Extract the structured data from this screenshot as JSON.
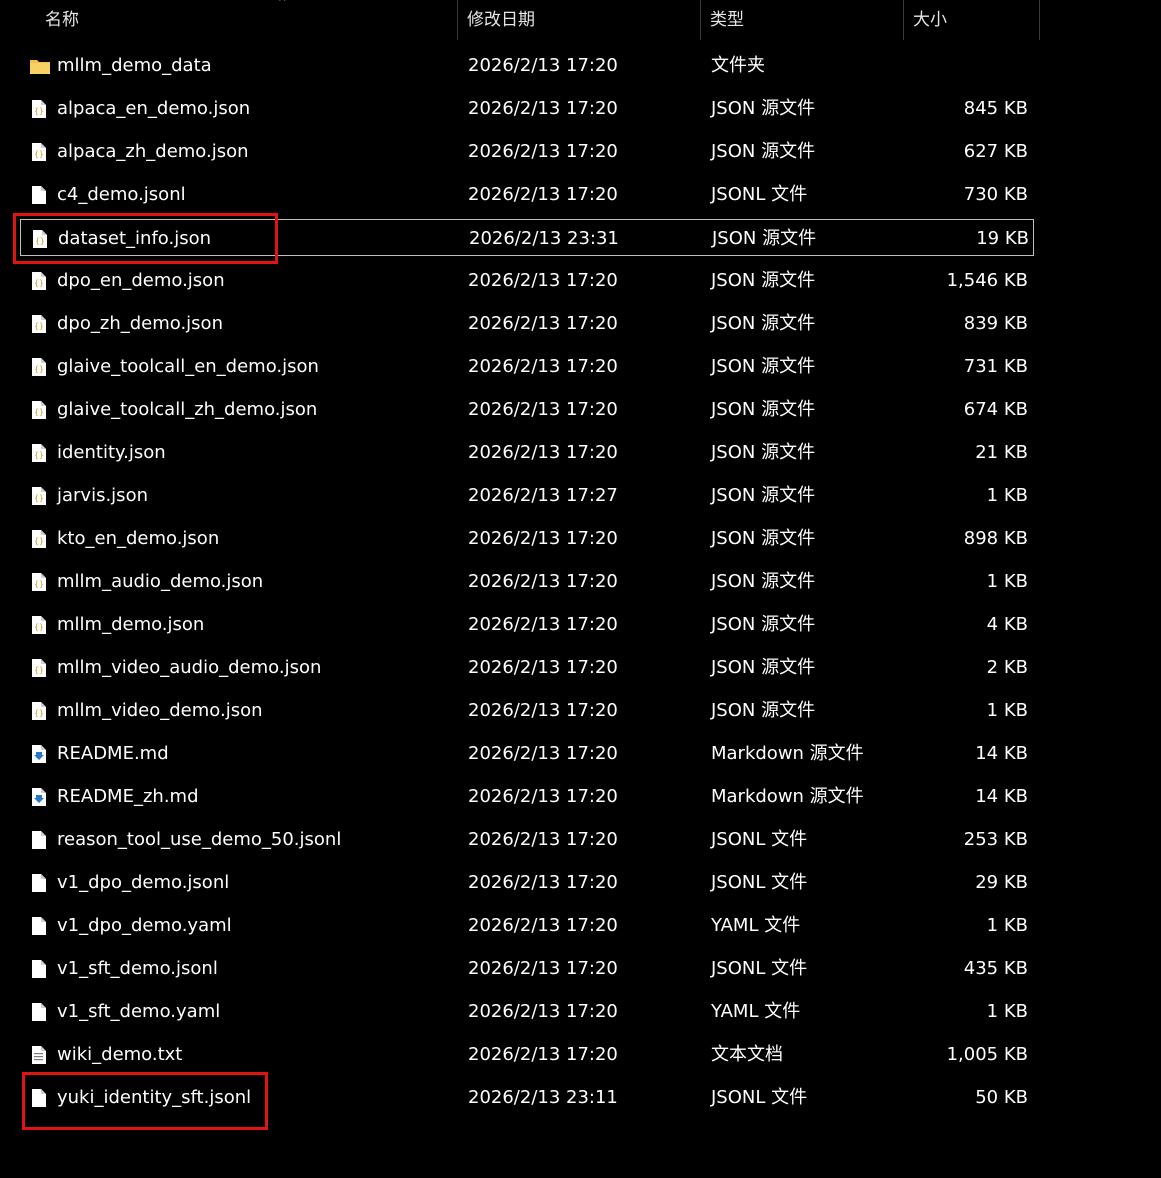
{
  "columns": {
    "name": "名称",
    "date": "修改日期",
    "type": "类型",
    "size": "大小"
  },
  "sort": {
    "column": "name",
    "direction": "ascending",
    "indicator": "^"
  },
  "files": [
    {
      "icon": "folder",
      "name": "mllm_demo_data",
      "date": "2026/2/13 17:20",
      "type": "文件夹",
      "size": ""
    },
    {
      "icon": "json",
      "name": "alpaca_en_demo.json",
      "date": "2026/2/13 17:20",
      "type": "JSON 源文件",
      "size": "845 KB"
    },
    {
      "icon": "json",
      "name": "alpaca_zh_demo.json",
      "date": "2026/2/13 17:20",
      "type": "JSON 源文件",
      "size": "627 KB"
    },
    {
      "icon": "blank",
      "name": "c4_demo.jsonl",
      "date": "2026/2/13 17:20",
      "type": "JSONL 文件",
      "size": "730 KB"
    },
    {
      "icon": "json",
      "name": "dataset_info.json",
      "date": "2026/2/13 23:31",
      "type": "JSON 源文件",
      "size": "19 KB",
      "selected": true,
      "highlighted": true
    },
    {
      "icon": "json",
      "name": "dpo_en_demo.json",
      "date": "2026/2/13 17:20",
      "type": "JSON 源文件",
      "size": "1,546 KB"
    },
    {
      "icon": "json",
      "name": "dpo_zh_demo.json",
      "date": "2026/2/13 17:20",
      "type": "JSON 源文件",
      "size": "839 KB"
    },
    {
      "icon": "json",
      "name": "glaive_toolcall_en_demo.json",
      "date": "2026/2/13 17:20",
      "type": "JSON 源文件",
      "size": "731 KB"
    },
    {
      "icon": "json",
      "name": "glaive_toolcall_zh_demo.json",
      "date": "2026/2/13 17:20",
      "type": "JSON 源文件",
      "size": "674 KB"
    },
    {
      "icon": "json",
      "name": "identity.json",
      "date": "2026/2/13 17:20",
      "type": "JSON 源文件",
      "size": "21 KB"
    },
    {
      "icon": "json",
      "name": "jarvis.json",
      "date": "2026/2/13 17:27",
      "type": "JSON 源文件",
      "size": "1 KB"
    },
    {
      "icon": "json",
      "name": "kto_en_demo.json",
      "date": "2026/2/13 17:20",
      "type": "JSON 源文件",
      "size": "898 KB"
    },
    {
      "icon": "json",
      "name": "mllm_audio_demo.json",
      "date": "2026/2/13 17:20",
      "type": "JSON 源文件",
      "size": "1 KB"
    },
    {
      "icon": "json",
      "name": "mllm_demo.json",
      "date": "2026/2/13 17:20",
      "type": "JSON 源文件",
      "size": "4 KB"
    },
    {
      "icon": "json",
      "name": "mllm_video_audio_demo.json",
      "date": "2026/2/13 17:20",
      "type": "JSON 源文件",
      "size": "2 KB"
    },
    {
      "icon": "json",
      "name": "mllm_video_demo.json",
      "date": "2026/2/13 17:20",
      "type": "JSON 源文件",
      "size": "1 KB"
    },
    {
      "icon": "markdown",
      "name": "README.md",
      "date": "2026/2/13 17:20",
      "type": "Markdown 源文件",
      "size": "14 KB"
    },
    {
      "icon": "markdown",
      "name": "README_zh.md",
      "date": "2026/2/13 17:20",
      "type": "Markdown 源文件",
      "size": "14 KB"
    },
    {
      "icon": "blank",
      "name": "reason_tool_use_demo_50.jsonl",
      "date": "2026/2/13 17:20",
      "type": "JSONL 文件",
      "size": "253 KB"
    },
    {
      "icon": "blank",
      "name": "v1_dpo_demo.jsonl",
      "date": "2026/2/13 17:20",
      "type": "JSONL 文件",
      "size": "29 KB"
    },
    {
      "icon": "blank",
      "name": "v1_dpo_demo.yaml",
      "date": "2026/2/13 17:20",
      "type": "YAML 文件",
      "size": "1 KB"
    },
    {
      "icon": "blank",
      "name": "v1_sft_demo.jsonl",
      "date": "2026/2/13 17:20",
      "type": "JSONL 文件",
      "size": "435 KB"
    },
    {
      "icon": "blank",
      "name": "v1_sft_demo.yaml",
      "date": "2026/2/13 17:20",
      "type": "YAML 文件",
      "size": "1 KB"
    },
    {
      "icon": "text",
      "name": "wiki_demo.txt",
      "date": "2026/2/13 17:20",
      "type": "文本文档",
      "size": "1,005 KB"
    },
    {
      "icon": "blank",
      "name": "yuki_identity_sft.jsonl",
      "date": "2026/2/13 23:11",
      "type": "JSONL 文件",
      "size": "50 KB",
      "highlighted": true
    }
  ],
  "colors": {
    "background": "#000000",
    "text": "#ffffff",
    "header_text": "#e6e6e6",
    "highlight_box": "#e11414",
    "selection_border": "#bfbfbf",
    "folder": "#f4c04a"
  }
}
